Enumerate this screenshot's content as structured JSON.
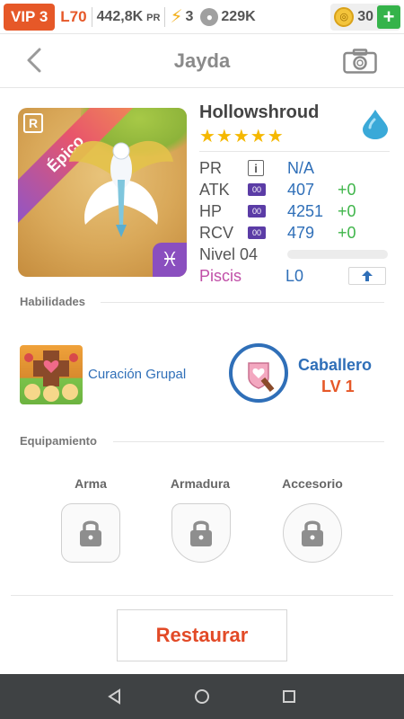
{
  "status_bar": {
    "vip": "VIP 3",
    "level": "L70",
    "power": "442,8K",
    "power_unit": "PR",
    "energy": "3",
    "paws": "229K",
    "gems": "30",
    "plus": "+"
  },
  "header": {
    "title": "Jayda"
  },
  "hero": {
    "rarity": "Épico",
    "rank_badge": "R",
    "zodiac_symbol": "♓",
    "name": "Hollowshroud",
    "stars": 5,
    "stars_text": "★★★★★",
    "stats": [
      {
        "key": "PR",
        "badge": "i",
        "value": "N/A",
        "bonus": ""
      },
      {
        "key": "ATK",
        "badge": "00",
        "value": "407",
        "bonus": "+0"
      },
      {
        "key": "HP",
        "badge": "00",
        "value": "4251",
        "bonus": "+0"
      },
      {
        "key": "RCV",
        "badge": "00",
        "value": "479",
        "bonus": "+0"
      }
    ],
    "level_label": "Nivel 04",
    "level_progress": 0,
    "zodiac_name": "Piscis",
    "zodiac_level": "L0"
  },
  "skills": {
    "section_title": "Habilidades",
    "skill_name": "Curación Grupal",
    "class_name": "Caballero",
    "class_level": "LV 1"
  },
  "equipment": {
    "section_title": "Equipamiento",
    "slots": [
      {
        "label": "Arma",
        "icon": "lock-icon"
      },
      {
        "label": "Armadura",
        "icon": "lock-icon"
      },
      {
        "label": "Accesorio",
        "icon": "lock-icon"
      }
    ]
  },
  "actions": {
    "restore_label": "Restaurar"
  },
  "colors": {
    "accent_orange": "#e65828",
    "link_blue": "#2f6fb8",
    "star_gold": "#f5b800",
    "bonus_green": "#3fb54a"
  }
}
